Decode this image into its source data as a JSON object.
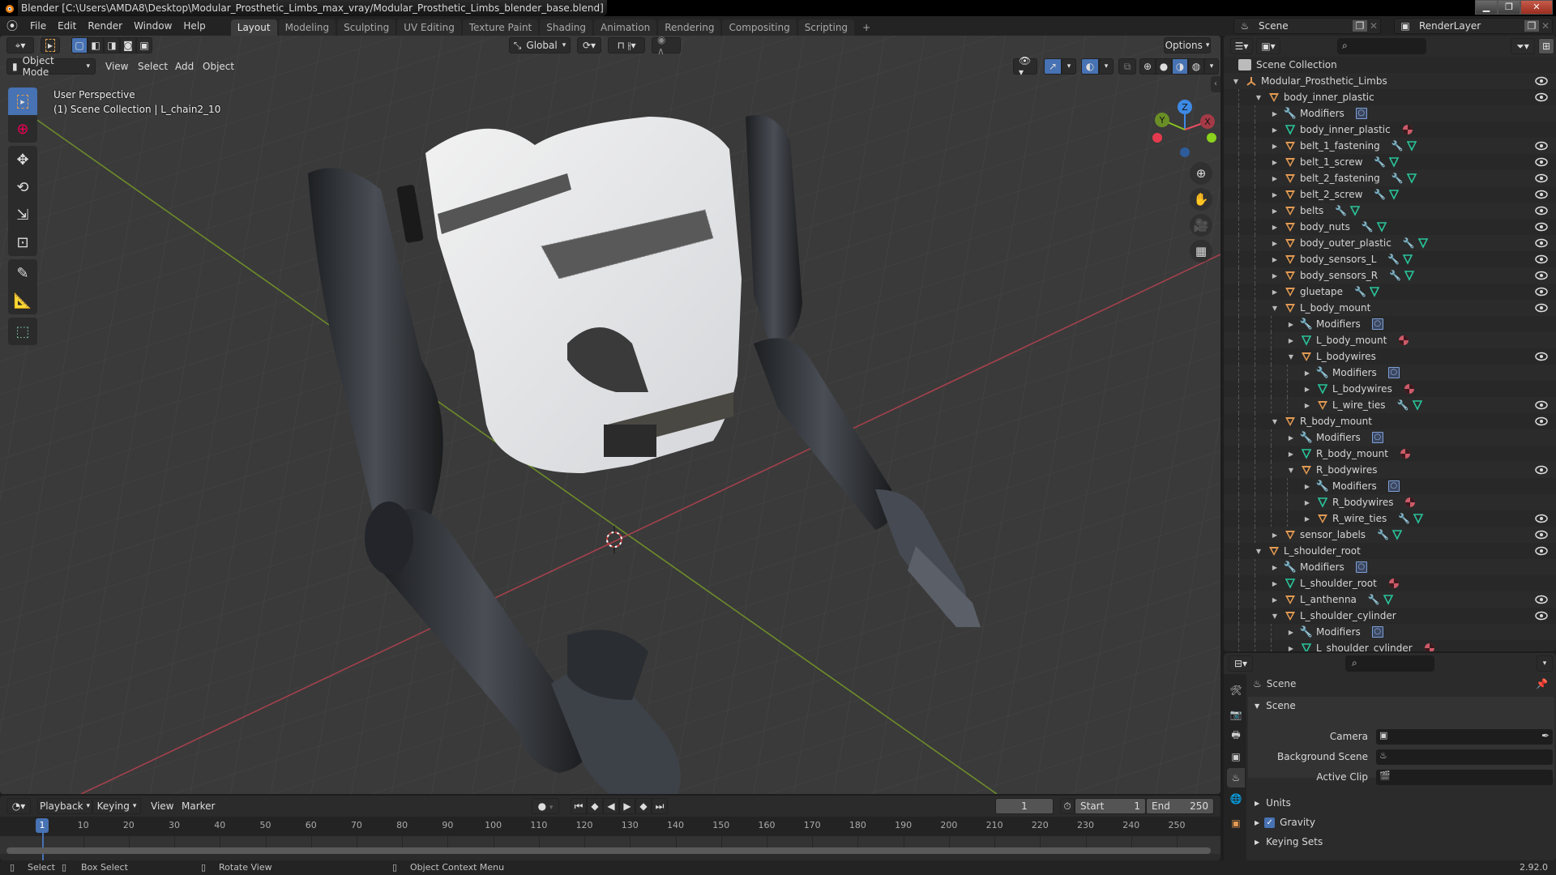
{
  "window": {
    "title": "Blender [C:\\Users\\AMDA8\\Desktop\\Modular_Prosthetic_Limbs_max_vray/Modular_Prosthetic_Limbs_blender_base.blend]",
    "controls": [
      "minimize",
      "maximize",
      "close"
    ]
  },
  "menu": {
    "items": [
      "File",
      "Edit",
      "Render",
      "Window",
      "Help"
    ]
  },
  "workspaces": {
    "tabs": [
      "Layout",
      "Modeling",
      "Sculpting",
      "UV Editing",
      "Texture Paint",
      "Shading",
      "Animation",
      "Rendering",
      "Compositing",
      "Scripting"
    ],
    "active": "Layout",
    "add_label": "+"
  },
  "scene_selector": {
    "scene": "Scene",
    "view_layer": "RenderLayer"
  },
  "viewport": {
    "mode": "Object Mode",
    "header_menus": [
      "View",
      "Select",
      "Add",
      "Object"
    ],
    "transform_orientation": "Global",
    "options_label": "Options",
    "info_line1": "User Perspective",
    "info_line2": "(1) Scene Collection | L_chain2_10",
    "shading_active": "material-preview",
    "gizmo_axes": [
      "X",
      "Y",
      "Z"
    ],
    "axis_colors": {
      "x": "#e54e5f",
      "y": "#8ac41f",
      "z": "#3d8ae6"
    },
    "tools": [
      "select-box",
      "cursor",
      "move",
      "rotate",
      "scale",
      "transform",
      "annotate",
      "measure",
      "add-cube"
    ],
    "nav_buttons": [
      "zoom",
      "pan",
      "camera",
      "ortho-grid"
    ]
  },
  "outliner": {
    "root_label": "Scene Collection",
    "rows": [
      {
        "depth": 0,
        "label": "Modular_Prosthetic_Limbs",
        "kind": "empty",
        "expanded": true,
        "eye": true,
        "extras": []
      },
      {
        "depth": 1,
        "label": "body_inner_plastic",
        "kind": "object",
        "expanded": true,
        "eye": true,
        "extras": []
      },
      {
        "depth": 2,
        "label": "Modifiers",
        "kind": "modifiers",
        "expanded": false,
        "eye": false,
        "extras": [
          "modifier-box"
        ]
      },
      {
        "depth": 2,
        "label": "body_inner_plastic",
        "kind": "mesh",
        "expanded": false,
        "eye": false,
        "extras": [
          "material"
        ]
      },
      {
        "depth": 2,
        "label": "belt_1_fastening",
        "kind": "object",
        "expanded": false,
        "eye": true,
        "extras": [
          "wrench",
          "mesh"
        ]
      },
      {
        "depth": 2,
        "label": "belt_1_screw",
        "kind": "object",
        "expanded": false,
        "eye": true,
        "extras": [
          "wrench",
          "mesh"
        ]
      },
      {
        "depth": 2,
        "label": "belt_2_fastening",
        "kind": "object",
        "expanded": false,
        "eye": true,
        "extras": [
          "wrench",
          "mesh"
        ]
      },
      {
        "depth": 2,
        "label": "belt_2_screw",
        "kind": "object",
        "expanded": false,
        "eye": true,
        "extras": [
          "wrench",
          "mesh"
        ]
      },
      {
        "depth": 2,
        "label": "belts",
        "kind": "object",
        "expanded": false,
        "eye": true,
        "extras": [
          "wrench",
          "mesh"
        ]
      },
      {
        "depth": 2,
        "label": "body_nuts",
        "kind": "object",
        "expanded": false,
        "eye": true,
        "extras": [
          "wrench",
          "mesh"
        ]
      },
      {
        "depth": 2,
        "label": "body_outer_plastic",
        "kind": "object",
        "expanded": false,
        "eye": true,
        "extras": [
          "wrench",
          "mesh"
        ]
      },
      {
        "depth": 2,
        "label": "body_sensors_L",
        "kind": "object",
        "expanded": false,
        "eye": true,
        "extras": [
          "wrench",
          "mesh"
        ]
      },
      {
        "depth": 2,
        "label": "body_sensors_R",
        "kind": "object",
        "expanded": false,
        "eye": true,
        "extras": [
          "wrench",
          "mesh"
        ]
      },
      {
        "depth": 2,
        "label": "gluetape",
        "kind": "object",
        "expanded": false,
        "eye": true,
        "extras": [
          "wrench",
          "mesh"
        ]
      },
      {
        "depth": 2,
        "label": "L_body_mount",
        "kind": "object",
        "expanded": true,
        "eye": true,
        "extras": []
      },
      {
        "depth": 3,
        "label": "Modifiers",
        "kind": "modifiers",
        "expanded": false,
        "eye": false,
        "extras": [
          "modifier-box"
        ]
      },
      {
        "depth": 3,
        "label": "L_body_mount",
        "kind": "mesh",
        "expanded": false,
        "eye": false,
        "extras": [
          "material"
        ]
      },
      {
        "depth": 3,
        "label": "L_bodywires",
        "kind": "object",
        "expanded": true,
        "eye": true,
        "extras": []
      },
      {
        "depth": 4,
        "label": "Modifiers",
        "kind": "modifiers",
        "expanded": false,
        "eye": false,
        "extras": [
          "modifier-box"
        ]
      },
      {
        "depth": 4,
        "label": "L_bodywires",
        "kind": "mesh",
        "expanded": false,
        "eye": false,
        "extras": [
          "material"
        ]
      },
      {
        "depth": 4,
        "label": "L_wire_ties",
        "kind": "object",
        "expanded": false,
        "eye": true,
        "extras": [
          "wrench",
          "mesh"
        ]
      },
      {
        "depth": 2,
        "label": "R_body_mount",
        "kind": "object",
        "expanded": true,
        "eye": true,
        "extras": []
      },
      {
        "depth": 3,
        "label": "Modifiers",
        "kind": "modifiers",
        "expanded": false,
        "eye": false,
        "extras": [
          "modifier-box"
        ]
      },
      {
        "depth": 3,
        "label": "R_body_mount",
        "kind": "mesh",
        "expanded": false,
        "eye": false,
        "extras": [
          "material"
        ]
      },
      {
        "depth": 3,
        "label": "R_bodywires",
        "kind": "object",
        "expanded": true,
        "eye": true,
        "extras": []
      },
      {
        "depth": 4,
        "label": "Modifiers",
        "kind": "modifiers",
        "expanded": false,
        "eye": false,
        "extras": [
          "modifier-box"
        ]
      },
      {
        "depth": 4,
        "label": "R_bodywires",
        "kind": "mesh",
        "expanded": false,
        "eye": false,
        "extras": [
          "material"
        ]
      },
      {
        "depth": 4,
        "label": "R_wire_ties",
        "kind": "object",
        "expanded": false,
        "eye": true,
        "extras": [
          "wrench",
          "mesh"
        ]
      },
      {
        "depth": 2,
        "label": "sensor_labels",
        "kind": "object",
        "expanded": false,
        "eye": true,
        "extras": [
          "wrench",
          "mesh"
        ]
      },
      {
        "depth": 1,
        "label": "L_shoulder_root",
        "kind": "object",
        "expanded": true,
        "eye": true,
        "extras": []
      },
      {
        "depth": 2,
        "label": "Modifiers",
        "kind": "modifiers",
        "expanded": false,
        "eye": false,
        "extras": [
          "modifier-box"
        ]
      },
      {
        "depth": 2,
        "label": "L_shoulder_root",
        "kind": "mesh",
        "expanded": false,
        "eye": false,
        "extras": [
          "material"
        ]
      },
      {
        "depth": 2,
        "label": "L_anthenna",
        "kind": "object",
        "expanded": false,
        "eye": true,
        "extras": [
          "wrench",
          "mesh"
        ]
      },
      {
        "depth": 2,
        "label": "L_shoulder_cylinder",
        "kind": "object",
        "expanded": true,
        "eye": true,
        "extras": []
      },
      {
        "depth": 3,
        "label": "Modifiers",
        "kind": "modifiers",
        "expanded": false,
        "eye": false,
        "extras": [
          "modifier-box"
        ]
      },
      {
        "depth": 3,
        "label": "L_shoulder_cylinder",
        "kind": "mesh",
        "expanded": false,
        "eye": false,
        "extras": [
          "material"
        ]
      }
    ]
  },
  "properties": {
    "context_label": "Scene",
    "panel_title": "Scene",
    "fields": [
      {
        "label": "Camera",
        "value": ""
      },
      {
        "label": "Background Scene",
        "value": ""
      },
      {
        "label": "Active Clip",
        "value": ""
      }
    ],
    "collapsed_panels": [
      {
        "label": "Units",
        "checkbox": false
      },
      {
        "label": "Gravity",
        "checkbox": true,
        "checked": true
      },
      {
        "label": "Keying Sets",
        "checkbox": false
      }
    ],
    "tabs": [
      "tool",
      "render",
      "output",
      "view-layer",
      "scene",
      "world",
      "object"
    ],
    "active_tab": "scene"
  },
  "timeline": {
    "menus": [
      "Playback",
      "Keying",
      "View",
      "Marker"
    ],
    "current_frame": "1",
    "start_label": "Start",
    "start": "1",
    "end_label": "End",
    "end": "250",
    "ruler": [
      "10",
      "20",
      "30",
      "40",
      "50",
      "60",
      "70",
      "80",
      "90",
      "100",
      "110",
      "120",
      "130",
      "140",
      "150",
      "160",
      "170",
      "180",
      "190",
      "200",
      "210",
      "220",
      "230",
      "240",
      "250"
    ],
    "playhead_label": "1"
  },
  "statusbar": {
    "select": "Select",
    "box_select": "Box Select",
    "rotate_view": "Rotate View",
    "context_menu": "Object Context Menu",
    "version": "2.92.0"
  }
}
